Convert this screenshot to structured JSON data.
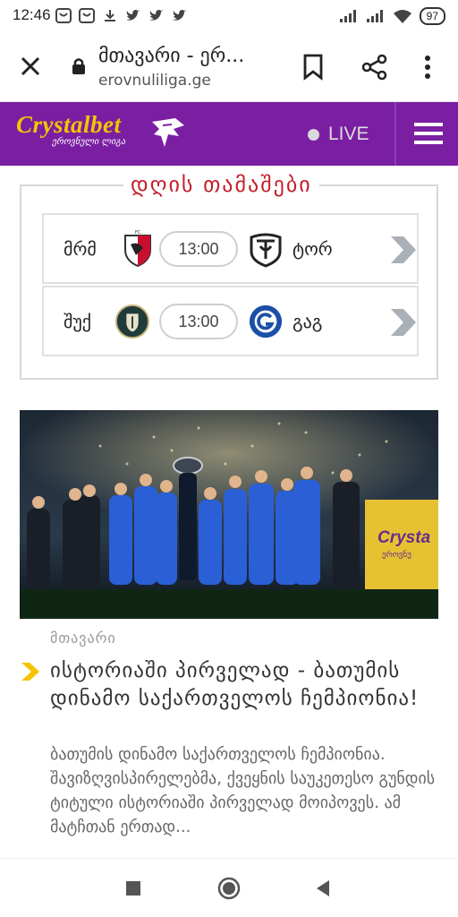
{
  "status_bar": {
    "time": "12:46",
    "battery": "97",
    "notification_icons": [
      "messenger-icon",
      "messenger-icon",
      "download-icon",
      "twitter-icon",
      "twitter-icon",
      "twitter-icon"
    ],
    "system_icons": [
      "signal-icon",
      "signal-icon",
      "wifi-icon",
      "battery-icon"
    ]
  },
  "browser": {
    "page_title": "მთავარი - ერ...",
    "host": "erovnuliliga.ge",
    "close_icon": "close-icon",
    "lock_icon": "lock-icon",
    "bookmark_icon": "bookmark-icon",
    "share_icon": "share-icon",
    "more_icon": "more-vertical-icon"
  },
  "site_header": {
    "brand": "Crystalbet",
    "brand_subtitle": "ეროვნული ლიგა",
    "live_label": "LIVE",
    "menu_icon": "hamburger-icon",
    "brand_color": "#7a1fa2",
    "logo_color": "#f5c400"
  },
  "games": {
    "title": "დღის თამაშები",
    "title_color": "#c41e2a",
    "matches": [
      {
        "home": "მრმ",
        "time": "13:00",
        "away": "ტორ",
        "home_crest": "merani-crest-icon",
        "away_crest": "torpedo-crest-icon"
      },
      {
        "home": "შუქ",
        "time": "13:00",
        "away": "გაგ",
        "home_crest": "shukura-crest-icon",
        "away_crest": "gagra-crest-icon"
      }
    ]
  },
  "article": {
    "image_alt": "team-celebration-photo",
    "category": "მთავარი",
    "headline": "ისტორიაში პირველად - ბათუმის დინამო საქართველოს ჩემპიონია!",
    "excerpt": "ბათუმის დინამო საქართველოს ჩემპიონია. შავიზღვისპირელებმა, ქვეყნის საუკეთესო გუნდის ტიტული ისტორიაში პირველად მოიპოვეს. ამ მატჩთან ერთად...",
    "photo_banner_text": "Crysta",
    "photo_banner_sub": "ეროვნუ"
  },
  "android_nav": {
    "buttons": [
      "recent-apps-icon",
      "home-icon",
      "back-icon"
    ]
  }
}
